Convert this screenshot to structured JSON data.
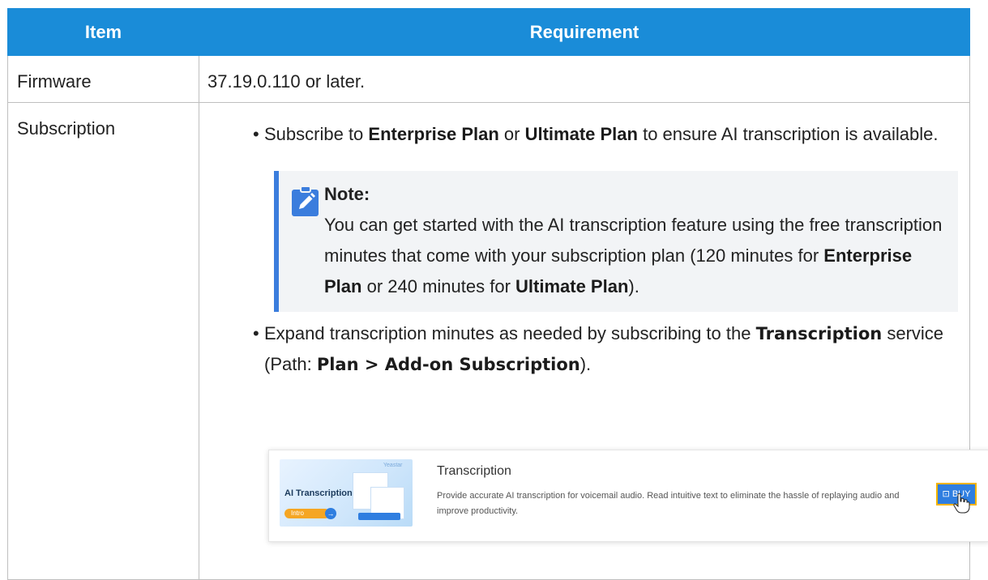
{
  "table": {
    "headers": [
      "Item",
      "Requirement"
    ],
    "rows": {
      "firmware": {
        "item": "Firmware",
        "value": "37.19.0.110 or later."
      },
      "subscription": {
        "item": "Subscription",
        "bullet1": {
          "pre": "Subscribe to ",
          "b1": "Enterprise Plan",
          "mid": " or ",
          "b2": "Ultimate Plan",
          "post": " to ensure AI transcription is available."
        },
        "note": {
          "title": "Note:",
          "pre": "You can get started with the AI transcription feature using the free transcription minutes that come with your subscription plan (120 minutes for ",
          "b1": "Enterprise Plan",
          "mid": " or 240 minutes for ",
          "b2": "Ultimate Plan",
          "post": ")."
        },
        "bullet2": {
          "pre": "Expand transcription minutes as needed by subscribing to the ",
          "b1": "Transcription",
          "mid": " service (Path: ",
          "b2": "Plan > Add-on Subscription",
          "post": ")."
        }
      }
    }
  },
  "card": {
    "thumb_brand": "Yeastar",
    "thumb_title": "AI Transcription",
    "thumb_pill": "Intro",
    "title": "Transcription",
    "description": "Provide accurate AI transcription for voicemail audio. Read intuitive text to eliminate the hassle of replaying audio and improve productivity.",
    "buy_label": "BUY"
  },
  "colors": {
    "header": "#1a8cd8",
    "note_bar": "#3b7ddd",
    "buy_button": "#2f7ee0",
    "buy_outline": "#f5b400"
  }
}
